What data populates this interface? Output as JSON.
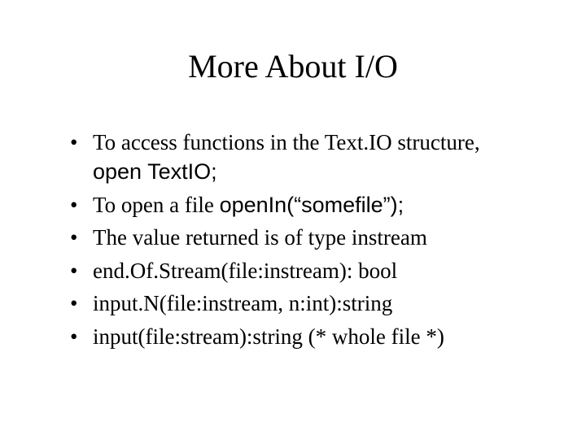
{
  "title": "More About I/O",
  "bullets": {
    "b1_line1": "To access functions in the Text.IO structure,",
    "b1_line2": "open TextIO;",
    "b2_prefix": "To open a file ",
    "b2_code": "openIn(“somefile”);",
    "b3": "The value returned is of type instream",
    "b4": "end.Of.Stream(file:instream): bool",
    "b5": "input.N(file:instream, n:int):string",
    "b6": "input(file:stream):string (* whole file *)"
  }
}
